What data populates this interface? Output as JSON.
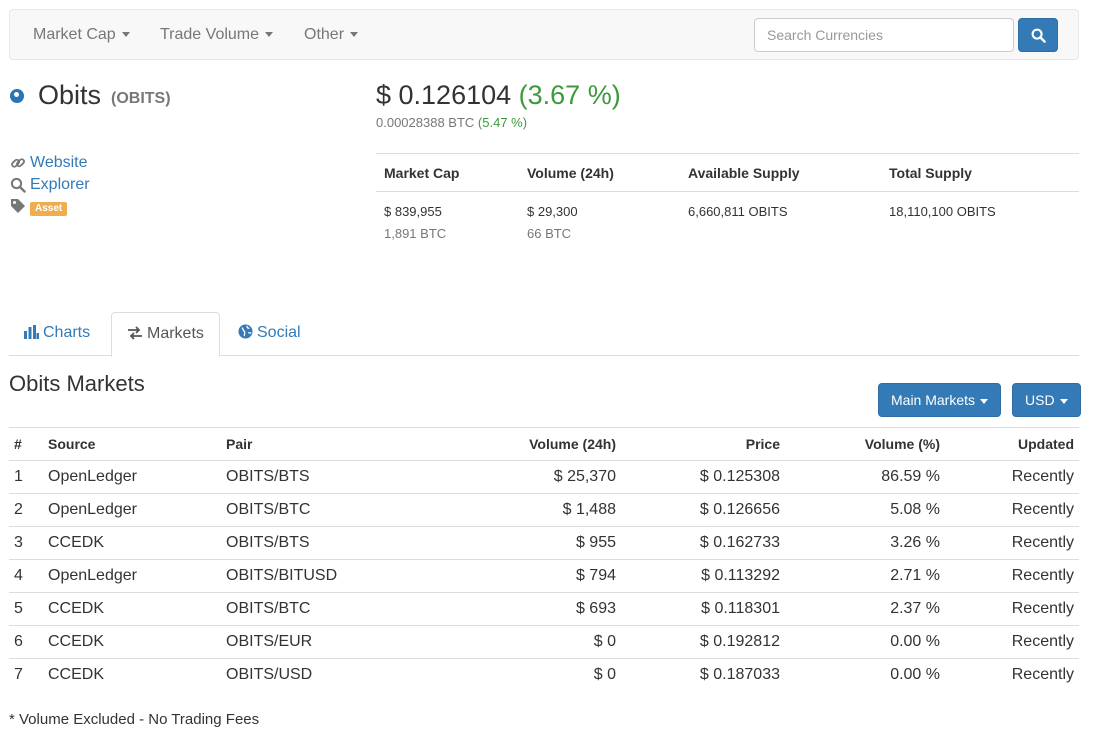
{
  "navbar": {
    "items": [
      {
        "label": "Market Cap"
      },
      {
        "label": "Trade Volume"
      },
      {
        "label": "Other"
      }
    ],
    "search_placeholder": "Search Currencies"
  },
  "coin": {
    "name": "Obits",
    "symbol": "(OBITS)",
    "price_usd": "$ 0.126104",
    "price_change": "(3.67 %)",
    "price_btc": "0.00028388 BTC",
    "price_btc_change": "(5.47 %)",
    "links": {
      "website": "Website",
      "explorer": "Explorer",
      "tag": "Asset"
    }
  },
  "stats": {
    "headers": [
      "Market Cap",
      "Volume (24h)",
      "Available Supply",
      "Total Supply"
    ],
    "market_cap_usd": "$ 839,955",
    "market_cap_btc": "1,891 BTC",
    "volume_usd": "$ 29,300",
    "volume_btc": "66 BTC",
    "available_supply": "6,660,811 OBITS",
    "total_supply": "18,110,100 OBITS"
  },
  "tabs": [
    {
      "label": "Charts"
    },
    {
      "label": "Markets"
    },
    {
      "label": "Social"
    }
  ],
  "markets": {
    "title": "Obits Markets",
    "main_markets_button": "Main Markets",
    "currency_button": "USD",
    "headers": [
      "#",
      "Source",
      "Pair",
      "Volume (24h)",
      "Price",
      "Volume (%)",
      "Updated"
    ],
    "rows": [
      {
        "num": "1",
        "source": "OpenLedger",
        "pair": "OBITS/BTS",
        "volume": "$ 25,370",
        "price": "$ 0.125308",
        "volume_pct": "86.59 %",
        "updated": "Recently"
      },
      {
        "num": "2",
        "source": "OpenLedger",
        "pair": "OBITS/BTC",
        "volume": "$ 1,488",
        "price": "$ 0.126656",
        "volume_pct": "5.08 %",
        "updated": "Recently"
      },
      {
        "num": "3",
        "source": "CCEDK",
        "pair": "OBITS/BTS",
        "volume": "$ 955",
        "price": "$ 0.162733",
        "volume_pct": "3.26 %",
        "updated": "Recently"
      },
      {
        "num": "4",
        "source": "OpenLedger",
        "pair": "OBITS/BITUSD",
        "volume": "$ 794",
        "price": "$ 0.113292",
        "volume_pct": "2.71 %",
        "updated": "Recently"
      },
      {
        "num": "5",
        "source": "CCEDK",
        "pair": "OBITS/BTC",
        "volume": "$ 693",
        "price": "$ 0.118301",
        "volume_pct": "2.37 %",
        "updated": "Recently"
      },
      {
        "num": "6",
        "source": "CCEDK",
        "pair": "OBITS/EUR",
        "volume": "$ 0",
        "price": "$ 0.192812",
        "volume_pct": "0.00 %",
        "updated": "Recently"
      },
      {
        "num": "7",
        "source": "CCEDK",
        "pair": "OBITS/USD",
        "volume": "$ 0",
        "price": "$ 0.187033",
        "volume_pct": "0.00 %",
        "updated": "Recently"
      }
    ],
    "footnote": "* Volume Excluded - No Trading Fees"
  },
  "colors": {
    "link": "#337ab7",
    "positive": "#3c9a3c",
    "asset_label": "#f0ad4e",
    "primary_button": "#337ab7"
  },
  "icons": {
    "search": "search-icon",
    "website": "link-icon",
    "explorer": "magnifier-icon",
    "tag": "tag-icon",
    "charts": "bar-chart-icon",
    "markets": "transfer-arrows-icon",
    "social": "globe-icon"
  }
}
